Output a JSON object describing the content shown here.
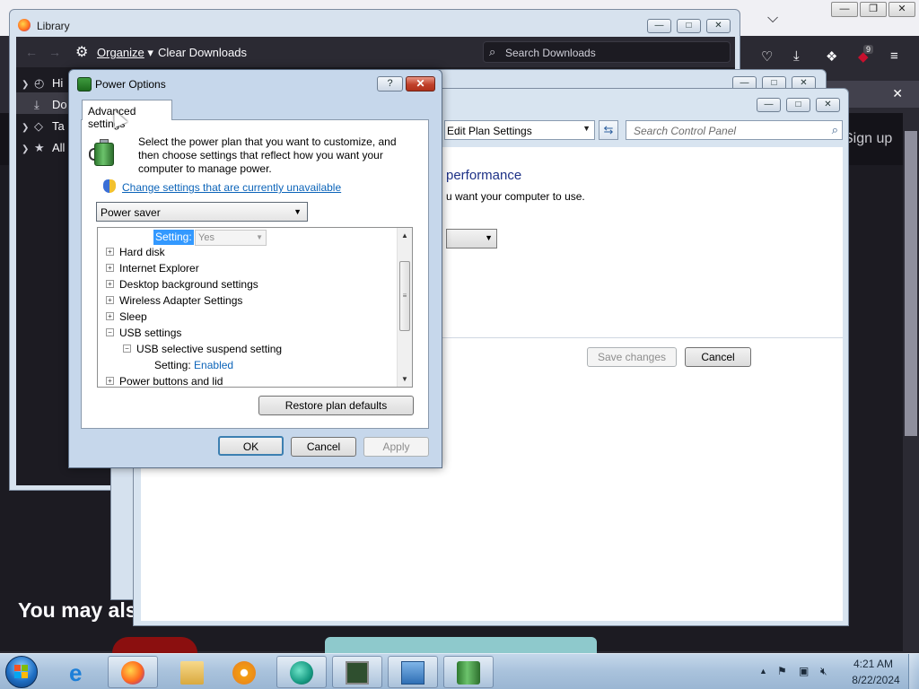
{
  "firefox": {
    "notification_close": "✕",
    "badge_count": "9",
    "signup_text": "Sign up",
    "you_may_also": "You may als"
  },
  "library": {
    "title": "Library",
    "organize_label": "Organize",
    "clear_downloads_label": "Clear Downloads",
    "search_placeholder": "Search Downloads",
    "sidebar": [
      {
        "label": "Hi",
        "icon": "clock-icon"
      },
      {
        "label": "Do",
        "icon": "download-icon"
      },
      {
        "label": "Ta",
        "icon": "tag-icon"
      },
      {
        "label": "All",
        "icon": "star-icon"
      }
    ]
  },
  "edit_plan": {
    "breadcrumb": "Edit Plan Settings",
    "search_placeholder": "Search Control Panel",
    "heading": "performance",
    "subtext": "u want your computer to use.",
    "save_label": "Save changes",
    "cancel_label": "Cancel"
  },
  "power_options": {
    "title": "Power Options",
    "help_label": "?",
    "close_label": "✕",
    "tab_label": "Advanced settings",
    "description": "Select the power plan that you want to customize, and then choose settings that reflect how you want your computer to manage power.",
    "change_link": "Change settings that are currently unavailable",
    "plan_selected": "Power saver",
    "setting_label": "Setting:",
    "setting_value": "Yes",
    "tree_items": [
      {
        "label": "Hard disk",
        "expanded": false
      },
      {
        "label": "Internet Explorer",
        "expanded": false
      },
      {
        "label": "Desktop background settings",
        "expanded": false
      },
      {
        "label": "Wireless Adapter Settings",
        "expanded": false
      },
      {
        "label": "Sleep",
        "expanded": false
      },
      {
        "label": "USB settings",
        "expanded": true
      },
      {
        "label": "USB selective suspend setting",
        "expanded": true
      },
      {
        "label": "Power buttons and lid",
        "expanded": false
      }
    ],
    "usb_setting_label": "Setting:",
    "usb_setting_value": "Enabled",
    "restore_label": "Restore plan defaults",
    "ok_label": "OK",
    "cancel_label": "Cancel",
    "apply_label": "Apply"
  },
  "taskbar": {
    "time": "4:21 AM",
    "date": "8/22/2024"
  }
}
